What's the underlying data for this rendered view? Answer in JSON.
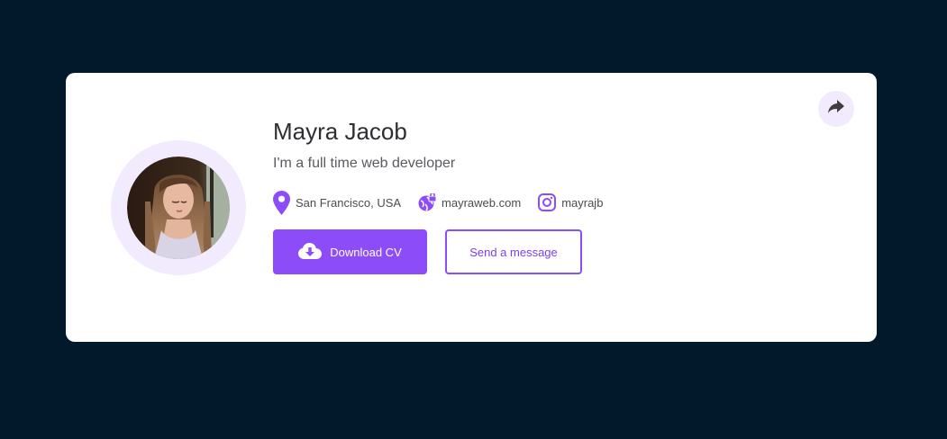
{
  "profile": {
    "name": "Mayra Jacob",
    "tagline": "I'm a full time web developer",
    "location": "San Francisco, USA",
    "website": "mayraweb.com",
    "instagram": "mayrajb"
  },
  "actions": {
    "download_label": "Download CV",
    "message_label": "Send a message"
  },
  "icons": {
    "share": "share-icon",
    "location": "map-pin-icon",
    "website": "globe-lock-icon",
    "instagram": "instagram-icon",
    "download": "cloud-download-icon"
  },
  "colors": {
    "background": "#02182b",
    "card": "#ffffff",
    "accent": "#8c4df8",
    "accent_light": "#f1ebfd",
    "text_primary": "#2e2e33",
    "text_secondary": "#5a5a60"
  }
}
